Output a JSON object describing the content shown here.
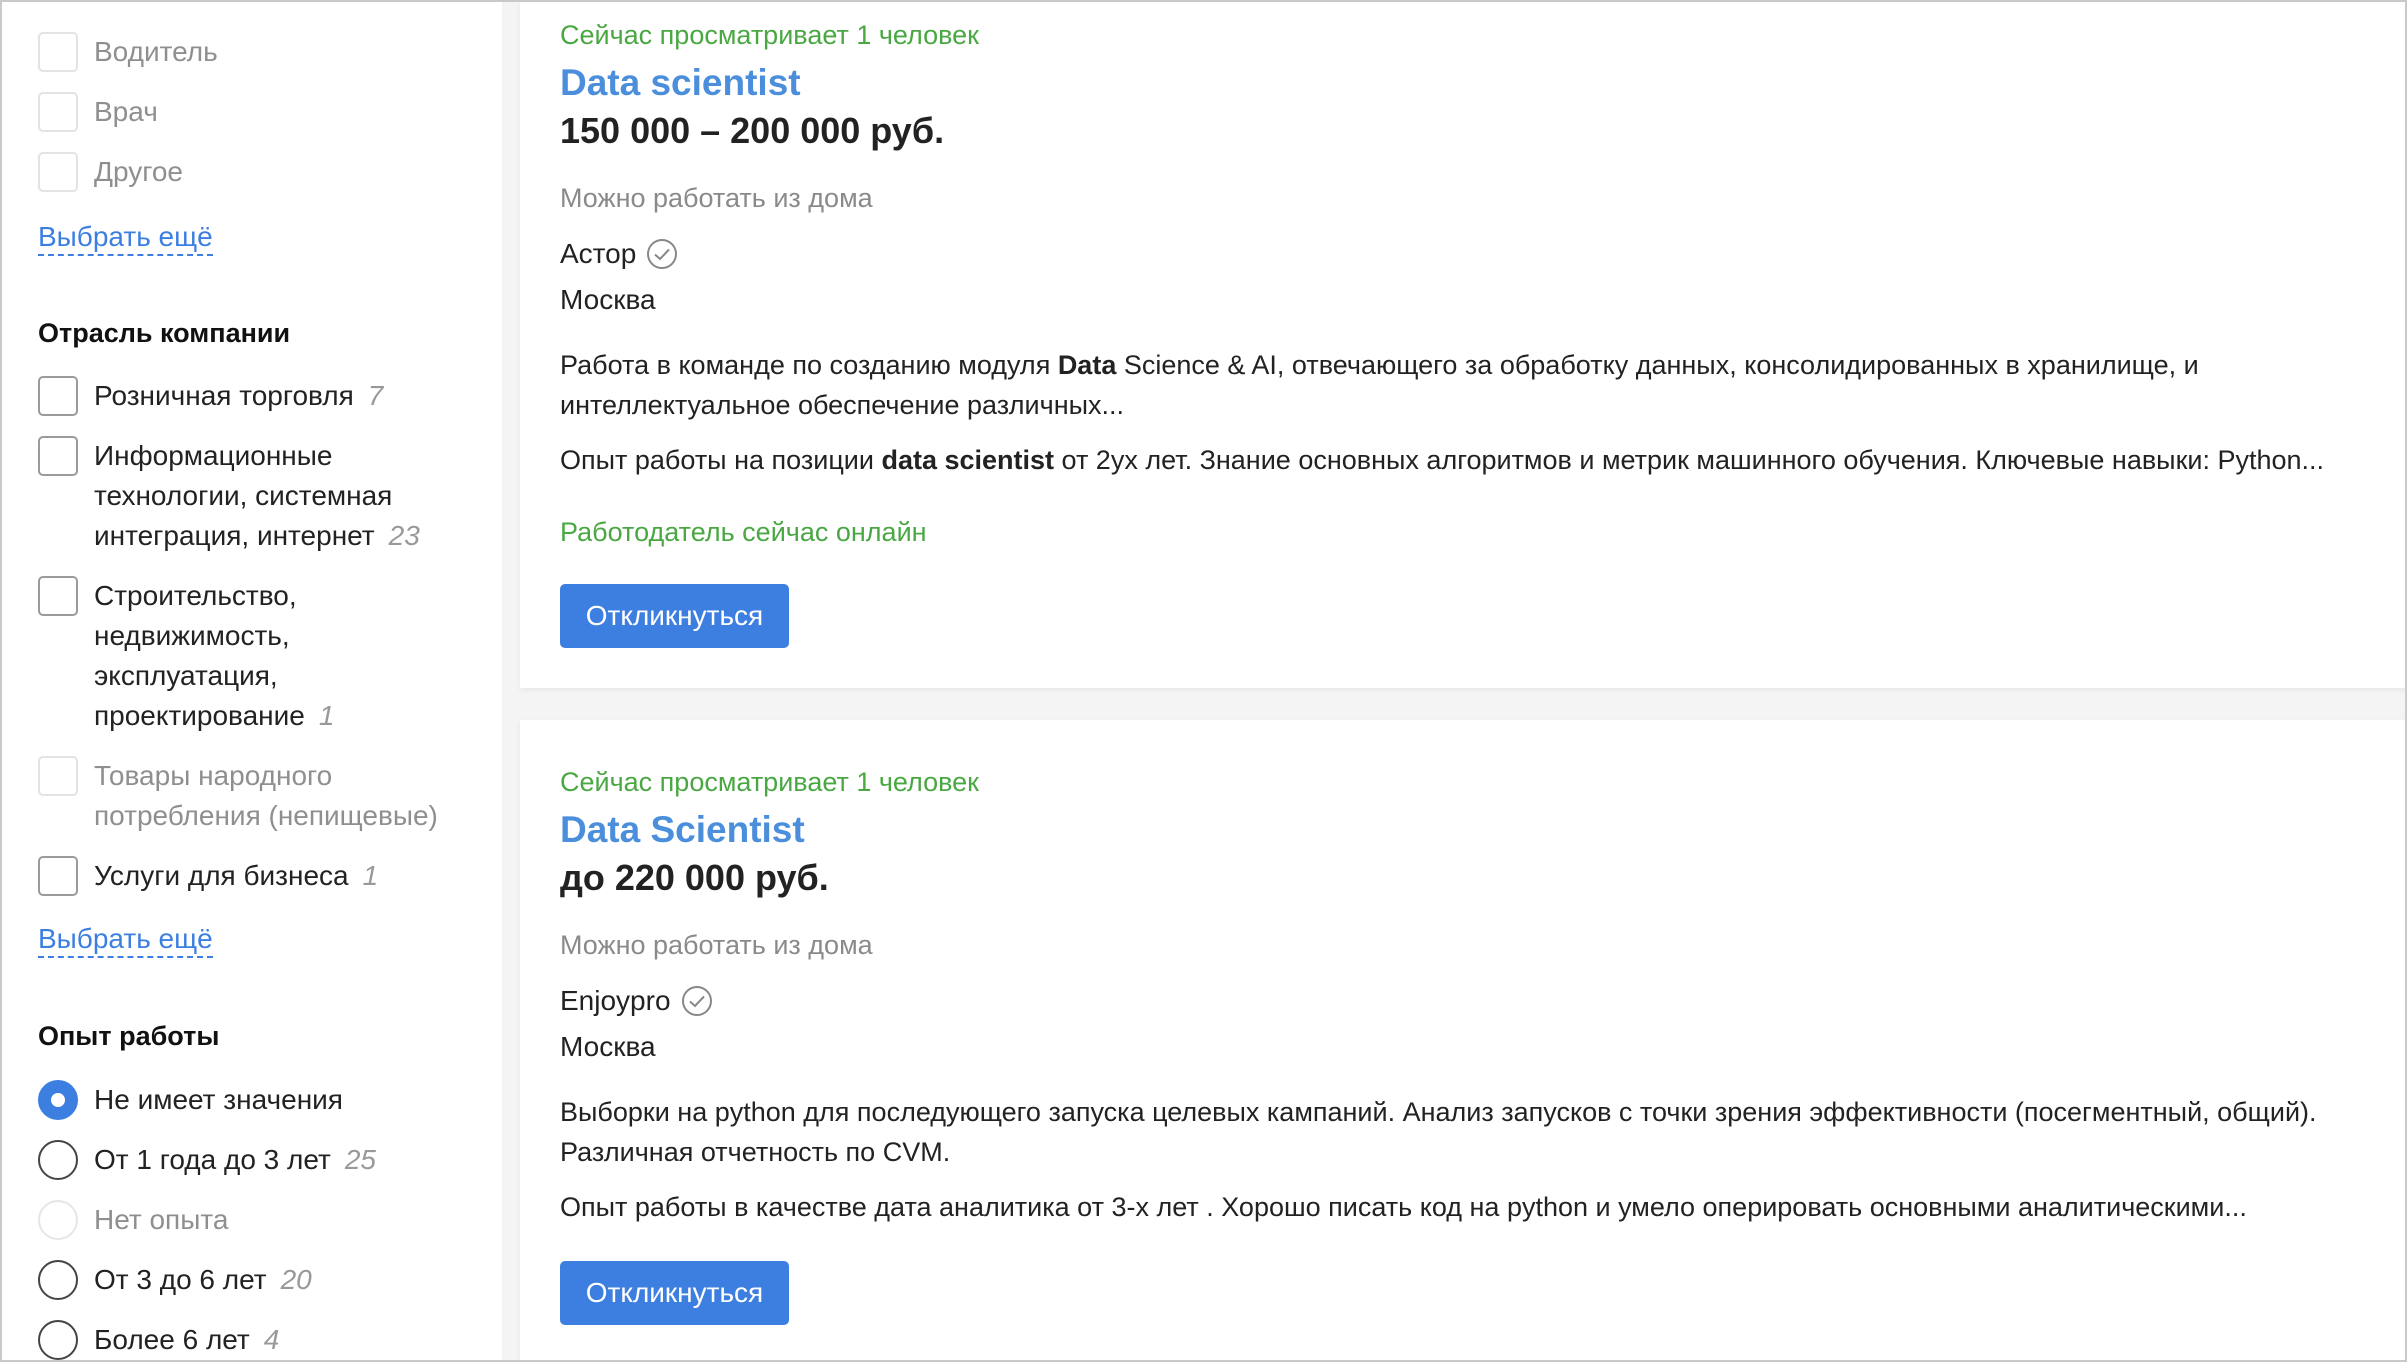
{
  "sidebar": {
    "profession_items": [
      {
        "label": "Водитель",
        "count": "",
        "disabled": true
      },
      {
        "label": "Врач",
        "count": "",
        "disabled": true
      },
      {
        "label": "Другое",
        "count": "",
        "disabled": true
      }
    ],
    "more_link_1": "Выбрать ещё",
    "industry_title": "Отрасль компании",
    "industry_items": [
      {
        "label_lines": [
          "Розничная торговля"
        ],
        "count": "7",
        "disabled": false
      },
      {
        "label_lines": [
          "Информационные",
          "технологии, системная",
          "интеграция, интернет"
        ],
        "count": "23",
        "disabled": false
      },
      {
        "label_lines": [
          "Строительство,",
          "недвижимость,",
          "эксплуатация,",
          "проектирование"
        ],
        "count": "1",
        "disabled": false
      },
      {
        "label_lines": [
          "Товары народного",
          "потребления (непищевые)"
        ],
        "count": "",
        "disabled": true
      },
      {
        "label_lines": [
          "Услуги для бизнеса"
        ],
        "count": "1",
        "disabled": false
      }
    ],
    "more_link_2": "Выбрать ещё",
    "experience_title": "Опыт работы",
    "experience_items": [
      {
        "label": "Не имеет значения",
        "count": "",
        "checked": true,
        "disabled": false
      },
      {
        "label": "От 1 года до 3 лет",
        "count": "25",
        "checked": false,
        "disabled": false
      },
      {
        "label": "Нет опыта",
        "count": "",
        "checked": false,
        "disabled": true
      },
      {
        "label": "От 3 до 6 лет",
        "count": "20",
        "checked": false,
        "disabled": false
      },
      {
        "label": "Более 6 лет",
        "count": "4",
        "checked": false,
        "disabled": false
      }
    ]
  },
  "vacancies": [
    {
      "views": "Сейчас просматривает 1 человек",
      "title": "Data scientist",
      "salary": "150 000 – 200 000 руб.",
      "remote": "Можно работать из дома",
      "company": "Астор",
      "city": "Москва",
      "desc1_parts": [
        "Работа в команде по созданию модуля ",
        "Data",
        " Science & AI, отвечающего за обработку данных, консолидированных в хранилище, и интеллектуальное обеспечение различных..."
      ],
      "desc2_parts": [
        "Опыт работы на позиции ",
        "data scientist",
        " от 2ух лет. Знание основных алгоритмов и метрик машинного обучения. Ключевые навыки: Python..."
      ],
      "online": "Работодатель сейчас онлайн",
      "button": "Откликнуться"
    },
    {
      "views": "Сейчас просматривает 1 человек",
      "title": "Data Scientist",
      "salary": "до 220 000 руб.",
      "remote": "Можно работать из дома",
      "company": "Enjoypro",
      "city": "Москва",
      "desc1": "Выборки на python для последующего запуска целевых кампаний. Анализ запусков с точки зрения эффективности (посегментный, общий). Различная отчетность по CVM.",
      "desc2": "Опыт работы в качестве дата аналитика от 3-х лет . Хорошо писать код на python и умело оперировать основными аналитическими...",
      "button": "Откликнуться"
    }
  ],
  "icons": {
    "verified": "check-circle-icon"
  },
  "colors": {
    "accent": "#3d7fe0",
    "link_title": "#4a8edc",
    "online_green": "#4aa843"
  }
}
